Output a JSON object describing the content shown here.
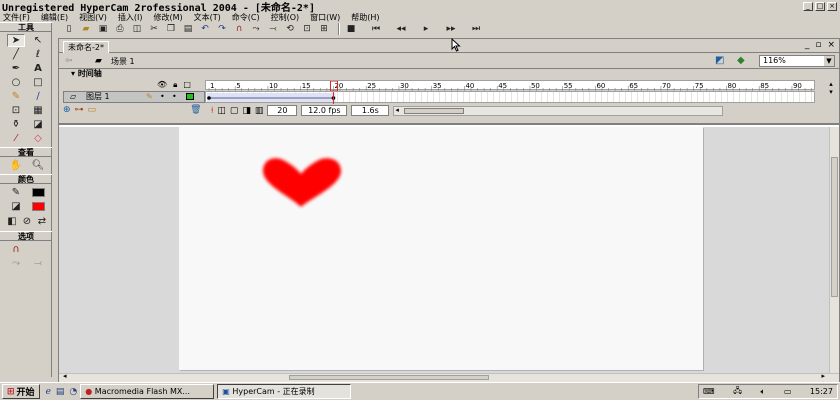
{
  "window": {
    "title": "Unregistered HyperCam 2rofessional 2004 - [未命名-2*]"
  },
  "menu": [
    "文件(F)",
    "编辑(E)",
    "视图(V)",
    "插入(I)",
    "修改(M)",
    "文本(T)",
    "命令(C)",
    "控制(O)",
    "窗口(W)",
    "帮助(H)"
  ],
  "tools": {
    "header": "工具",
    "view_header": "查看",
    "color_header": "颜色",
    "options_header": "选项",
    "stroke_color": "#000000",
    "fill_color": "#ff0000"
  },
  "document": {
    "tab_label": "未命名-2*",
    "scene_label": "场景 1",
    "zoom": "116%"
  },
  "timeline": {
    "title": "时间轴",
    "layer_name": "图层 1",
    "ruler_labels": [
      "1",
      "5",
      "10",
      "15",
      "20",
      "25",
      "30",
      "35",
      "40",
      "45",
      "50",
      "55",
      "60",
      "65",
      "70",
      "75",
      "80",
      "85",
      "90"
    ],
    "current_frame": "20",
    "frame_rate": "12.0 fps",
    "elapsed": "1.6s",
    "playhead_frame": 20
  },
  "stage": {
    "shape": "heart",
    "shape_color": "#ff0000"
  },
  "taskbar": {
    "start_label": "开始",
    "items": [
      "Macromedia Flash MX...",
      "HyperCam - 正在录制"
    ],
    "clock": "15:27"
  }
}
